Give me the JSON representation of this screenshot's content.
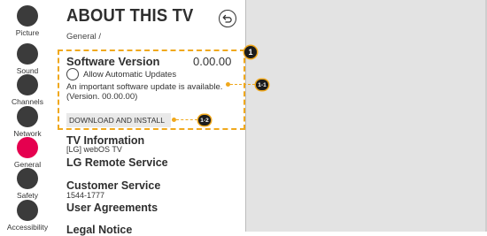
{
  "sidebar": {
    "items": [
      {
        "label": "Picture",
        "active": false
      },
      {
        "label": "Sound",
        "active": false
      },
      {
        "label": "Channels",
        "active": false
      },
      {
        "label": "Network",
        "active": false
      },
      {
        "label": "General",
        "active": true
      },
      {
        "label": "Safety",
        "active": false
      },
      {
        "label": "Accessibility",
        "active": false
      }
    ]
  },
  "header": {
    "title": "ABOUT THIS TV",
    "breadcrumb": "General /",
    "back_icon": "back-icon"
  },
  "software": {
    "title": "Software Version",
    "version": "0.00.00",
    "auto_update_label": "Allow Automatic Updates",
    "update_notice": "An important software update is available. (Version. 00.00.00)",
    "download_label": "DOWNLOAD AND INSTALL"
  },
  "menu": {
    "tv_info_title": "TV Information",
    "tv_info_value": "[LG] webOS TV",
    "remote_title": "LG Remote Service",
    "customer_title": "Customer Service",
    "customer_phone": "1544-1777",
    "agreements_title": "User Agreements",
    "legal_title": "Legal Notice"
  },
  "annotations": {
    "badge_main": "1",
    "badge_update": "1-1",
    "badge_download": "1-2"
  },
  "colors": {
    "accent": "#e5004f",
    "highlight": "#f0a81c",
    "nav_dot": "#3b3b3b",
    "right_area": "#e3e3e3"
  }
}
